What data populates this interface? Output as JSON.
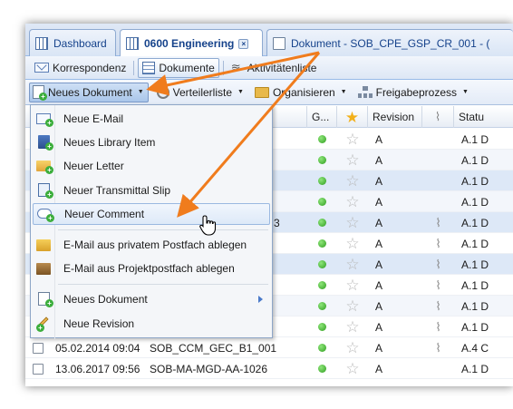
{
  "tabs": [
    {
      "label": "Dashboard",
      "icon": "grid-icon"
    },
    {
      "label": "0600 Engineering",
      "icon": "grid-icon",
      "active": true,
      "close": "×"
    },
    {
      "label": "Dokument - SOB_CPE_GSP_CR_001 - (",
      "icon": "document-icon"
    }
  ],
  "subtabs": [
    {
      "label": "Korrespondenz",
      "icon": "mail-icon"
    },
    {
      "label": "Dokumente",
      "icon": "table-icon",
      "active": true
    },
    {
      "label": "Aktivitätenliste",
      "icon": "activity-icon"
    }
  ],
  "toolbar": {
    "new_document": "Neues Dokument",
    "distribution_list": "Verteilerliste",
    "organize": "Organisieren",
    "approval_process": "Freigabeprozess"
  },
  "grid": {
    "columns": [
      "G...",
      "",
      "Revision",
      "",
      "Statu"
    ],
    "rows": [
      {
        "date": "",
        "name": "",
        "revision": "A",
        "status": "A.1 D",
        "attach": false,
        "style": "normal"
      },
      {
        "date": "",
        "name": "",
        "revision": "A",
        "status": "A.1 D",
        "attach": false,
        "style": "alt"
      },
      {
        "date": "",
        "name": "",
        "revision": "A",
        "status": "A.1 D",
        "attach": false,
        "style": "sel"
      },
      {
        "date": "",
        "name": "",
        "revision": "A",
        "status": "A.1 D",
        "attach": false,
        "style": "alt"
      },
      {
        "date": "",
        "name": "",
        "revision": "A",
        "status": "A.1 D",
        "attach": true,
        "style": "sel"
      },
      {
        "date": "",
        "name": "",
        "revision": "A",
        "status": "A.1 D",
        "attach": true,
        "style": "normal"
      },
      {
        "date": "",
        "name": "",
        "revision": "A",
        "status": "A.1 D",
        "attach": true,
        "style": "sel"
      },
      {
        "date": "",
        "name": "",
        "revision": "A",
        "status": "A.1 D",
        "attach": true,
        "style": "normal"
      },
      {
        "date": "",
        "name": "",
        "revision": "A",
        "status": "A.1 D",
        "attach": true,
        "style": "alt"
      },
      {
        "date": "",
        "name": "",
        "revision": "A",
        "status": "A.1 D",
        "attach": true,
        "style": "normal"
      },
      {
        "date": "05.02.2014 09:04",
        "name": "SOB_CCM_GEC_B1_001",
        "revision": "A",
        "status": "A.4 C",
        "attach": true,
        "style": "normal"
      },
      {
        "date": "13.06.2017 09:56",
        "name": "SOB-MA-MGD-AA-1026",
        "revision": "A",
        "status": "A.1 D",
        "attach": false,
        "style": "normal"
      }
    ],
    "partial_name_char": "3"
  },
  "menu": {
    "items": [
      {
        "label": "Neue E-Mail",
        "icon": "email-icon"
      },
      {
        "label": "Neues Library Item",
        "icon": "library-icon"
      },
      {
        "label": "Neuer Letter",
        "icon": "letter-icon"
      },
      {
        "label": "Neuer Transmittal Slip",
        "icon": "transmittal-icon"
      },
      {
        "label": "Neuer Comment",
        "icon": "comment-icon",
        "highlighted": true
      },
      {
        "label": "E-Mail aus privatem Postfach ablegen",
        "icon": "folder-icon"
      },
      {
        "label": "E-Mail aus Projektpostfach ablegen",
        "icon": "box-icon"
      },
      {
        "label": "Neues Dokument",
        "icon": "new-document-icon",
        "submenu": true
      },
      {
        "label": "Neue Revision",
        "icon": "pencil-icon"
      }
    ]
  },
  "colors": {
    "annotation_arrow": "#f07c1d",
    "selection": "#dde8f7",
    "header_blue": "#15428b"
  }
}
